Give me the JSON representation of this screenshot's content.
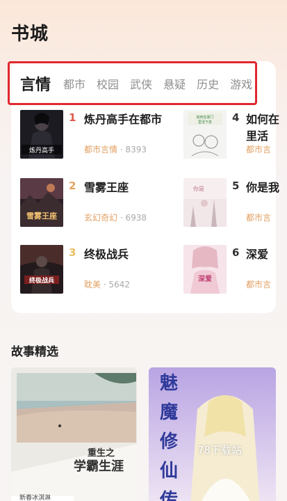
{
  "header": {
    "title": "书城"
  },
  "tabs": [
    {
      "label": "言情",
      "active": true
    },
    {
      "label": "都市",
      "active": false
    },
    {
      "label": "校园",
      "active": false
    },
    {
      "label": "武侠",
      "active": false
    },
    {
      "label": "悬疑",
      "active": false
    },
    {
      "label": "历史",
      "active": false
    },
    {
      "label": "游戏",
      "active": false
    }
  ],
  "ranking": {
    "left": [
      {
        "rank": "1",
        "title": "炼丹高手在都市",
        "category": "都市言情",
        "count": "8393",
        "rank_color": "#e0584b",
        "cover_text": "炼丹高手在都市"
      },
      {
        "rank": "2",
        "title": "雪雾王座",
        "category": "玄幻奇幻",
        "count": "6938",
        "rank_color": "#e7a45e",
        "cover_text": "雪雾王座"
      },
      {
        "rank": "3",
        "title": "终极战兵",
        "category": "耽美",
        "count": "5642",
        "rank_color": "#eac060",
        "cover_text": "终极战兵"
      }
    ],
    "right": [
      {
        "rank": "4",
        "title": "如何在",
        "title2": "里活",
        "category": "都市言",
        "count": ""
      },
      {
        "rank": "5",
        "title": "你是我",
        "category": "都市言",
        "count": ""
      },
      {
        "rank": "6",
        "title": "深爱",
        "category": "都市言",
        "count": ""
      }
    ],
    "separator": " · "
  },
  "section": {
    "title": "故事精选"
  },
  "featured": [
    {
      "title_line1": "重生之",
      "title_line2": "学霸生涯",
      "author": "新春冰淇淋"
    },
    {
      "title_chars": [
        "魅",
        "魔",
        "修",
        "仙",
        "传"
      ]
    }
  ],
  "watermark": "78下载站",
  "colors": {
    "tab_border": "#e0282f",
    "category": "#e2a063",
    "meta": "#a9a9a9"
  }
}
